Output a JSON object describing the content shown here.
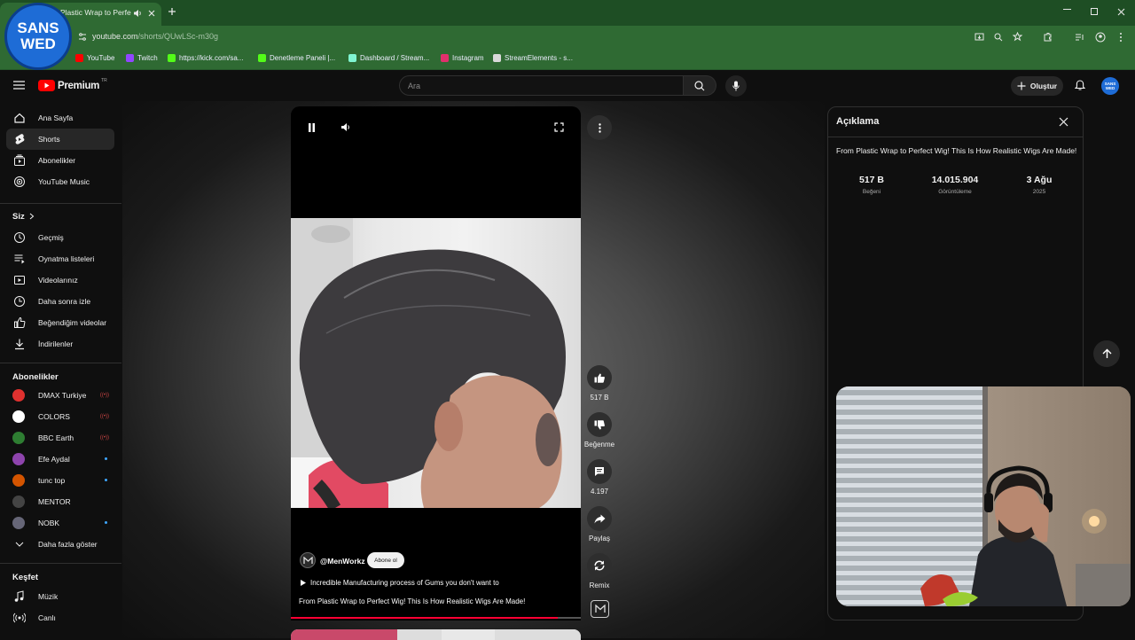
{
  "browser": {
    "tab_title": "Plastic Wrap to Perfect",
    "url_host": "youtube.com",
    "url_path": "/shorts/QUwLSc-m30g",
    "watermark_text": "SANS WED",
    "bookmarks": [
      {
        "label": "YouTube",
        "icon": "youtube-icon",
        "color": "#ff0000"
      },
      {
        "label": "Twitch",
        "icon": "twitch-icon",
        "color": "#9146ff"
      },
      {
        "label": "https://kick.com/sa...",
        "icon": "kick-icon",
        "color": "#53fc18"
      },
      {
        "label": "Denetleme Paneli |...",
        "icon": "kick-icon",
        "color": "#53fc18"
      },
      {
        "label": "Dashboard / Stream...",
        "icon": "streamlabs-icon",
        "color": "#80f5d2"
      },
      {
        "label": "Instagram",
        "icon": "instagram-icon",
        "color": "#e1306c"
      },
      {
        "label": "StreamElements - s...",
        "icon": "streamelements-icon",
        "color": "#d9d9d9"
      }
    ]
  },
  "topbar": {
    "logo": "Premium",
    "logo_badge": "TR",
    "search_placeholder": "Ara",
    "create_label": "Oluştur",
    "avatar_text": "SANS WED"
  },
  "sidebar": {
    "main": [
      {
        "label": "Ana Sayfa",
        "icon": "home-icon"
      },
      {
        "label": "Shorts",
        "icon": "shorts-icon",
        "active": true
      },
      {
        "label": "Abonelikler",
        "icon": "subscriptions-icon"
      },
      {
        "label": "YouTube Music",
        "icon": "music-icon"
      }
    ],
    "you_heading": "Siz",
    "you": [
      {
        "label": "Geçmiş",
        "icon": "history-icon"
      },
      {
        "label": "Oynatma listeleri",
        "icon": "playlists-icon"
      },
      {
        "label": "Videolarınız",
        "icon": "your-videos-icon"
      },
      {
        "label": "Daha sonra izle",
        "icon": "watch-later-icon"
      },
      {
        "label": "Beğendiğim videolar",
        "icon": "liked-icon"
      },
      {
        "label": "İndirilenler",
        "icon": "download-icon"
      }
    ],
    "subs_heading": "Abonelikler",
    "subs": [
      {
        "label": "DMAX Turkiye",
        "color": "#e0312f",
        "live": true
      },
      {
        "label": "COLORS",
        "color": "#ffffff",
        "live": true
      },
      {
        "label": "BBC Earth",
        "color": "#2e7d32",
        "live": true
      },
      {
        "label": "Efe Aydal",
        "color": "#8e44ad",
        "dot": true
      },
      {
        "label": "tunc top",
        "color": "#d35400",
        "dot": true
      },
      {
        "label": "MENTOR",
        "color": "#444444"
      },
      {
        "label": "NOBK",
        "color": "#666677",
        "dot": true
      }
    ],
    "show_more": "Daha fazla göster",
    "explore_heading": "Keşfet",
    "explore": [
      {
        "label": "Müzik",
        "icon": "music-note-icon"
      },
      {
        "label": "Canlı",
        "icon": "live-icon"
      }
    ]
  },
  "short": {
    "channel": "@MenWorkz",
    "subscribe_label": "Abone ol",
    "music_line": "Incredible Manufacturing process of Gums you don't want to",
    "title": "From Plastic Wrap to Perfect Wig! This Is How Realistic Wigs Are Made!",
    "progress": 0.92,
    "actions": {
      "likes": "517 B",
      "dislike_label": "Beğenme",
      "comments": "4.197",
      "share_label": "Paylaş",
      "remix_label": "Remix"
    }
  },
  "description": {
    "heading": "Açıklama",
    "title": "From Plastic Wrap to Perfect Wig! This Is How Realistic Wigs Are Made!",
    "stats": [
      {
        "value": "517 B",
        "label": "Beğeni"
      },
      {
        "value": "14.015.904",
        "label": "Görüntüleme"
      },
      {
        "value": "3 Ağu",
        "label": "2025"
      }
    ]
  },
  "colors": {
    "accent": "#ff0000",
    "chrome_green": "#2f6a33",
    "bg": "#0f0f0f"
  }
}
